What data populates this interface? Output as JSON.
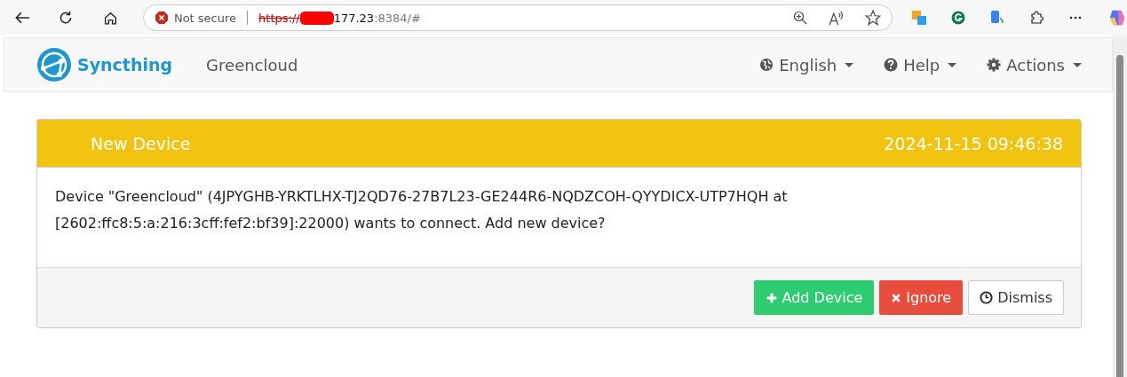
{
  "browser": {
    "security": "Not secure",
    "url": [
      {
        "kind": "scheme",
        "text": "https://"
      },
      {
        "kind": "redacted"
      },
      {
        "kind": "host",
        "text": "177.23"
      },
      {
        "kind": "rest",
        "text": ":8384/#"
      }
    ]
  },
  "navbar": {
    "brand": "Syncthing",
    "device_name": "Greencloud",
    "menus": [
      {
        "kind": "globe",
        "label": "English"
      },
      {
        "kind": "help",
        "label": "Help"
      },
      {
        "kind": "gear",
        "label": "Actions"
      }
    ]
  },
  "panel": {
    "title": "New Device",
    "time": "2024-11-15 09:46:38",
    "message": "Device \"Greencloud\" (4JPYGHB-YRKTLHX-TJ2QD76-27B7L23-GE244R6-NQDZCOH-QYYDICX-UTP7HQH at [2602:ffc8:5:a:216:3cff:fef2:bf39]:22000) wants to connect. Add new device?",
    "buttons": [
      {
        "kind": "add",
        "label": "Add Device"
      },
      {
        "kind": "ignore",
        "label": "Ignore"
      },
      {
        "kind": "dismiss",
        "label": "Dismiss"
      }
    ]
  }
}
